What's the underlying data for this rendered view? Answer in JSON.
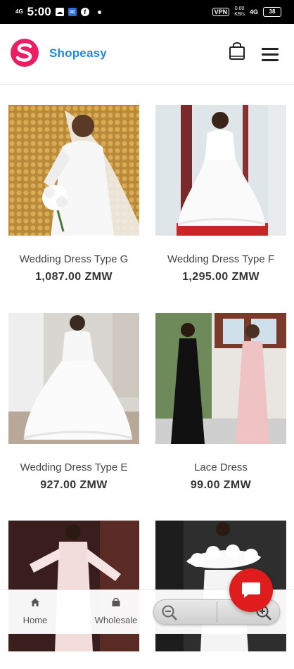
{
  "status_bar": {
    "signal": "4G",
    "time": "5:00",
    "vpn": "VPN",
    "speed_top": "0.00",
    "speed_bottom": "KB/s",
    "network": "4G",
    "battery": "38"
  },
  "header": {
    "brand": "Shopeasy",
    "logo_letter": "S",
    "brand_color": "#1e88e5",
    "logo_color": "#e91e63"
  },
  "products": [
    {
      "name": "Wedding Dress Type G",
      "price": "1,087.00 ZMW"
    },
    {
      "name": "Wedding Dress Type F",
      "price": "1,295.00 ZMW"
    },
    {
      "name": "Wedding Dress Type E",
      "price": "927.00 ZMW"
    },
    {
      "name": "Lace Dress",
      "price": "99.00 ZMW"
    },
    {
      "name": "",
      "price": ""
    },
    {
      "name": "",
      "price": ""
    }
  ],
  "bottom_nav": {
    "items": [
      {
        "label": "Home",
        "icon": "home-icon"
      },
      {
        "label": "Wholesale",
        "icon": "shop-icon"
      }
    ]
  },
  "zoom": {
    "out_icon": "zoom-out-icon",
    "in_icon": "zoom-in-icon"
  },
  "chat": {
    "icon": "chat-icon",
    "color": "#e01d1d"
  }
}
